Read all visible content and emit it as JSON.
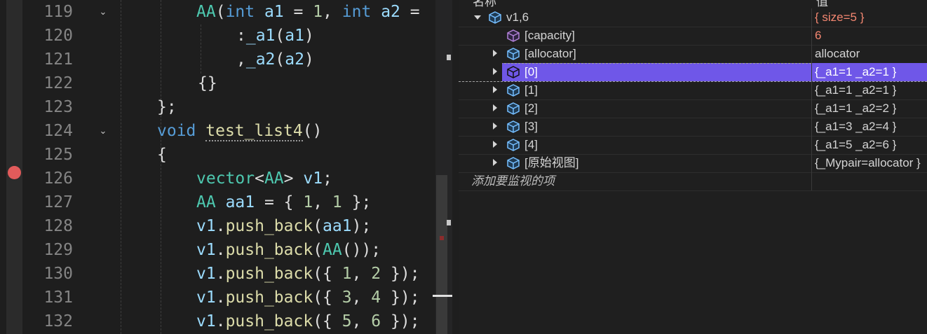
{
  "editor": {
    "lines": [
      {
        "num": "119",
        "code": "AA(int a1 = 1, int a2 ="
      },
      {
        "num": "120",
        "code": ":_a1(a1)"
      },
      {
        "num": "121",
        "code": ",_a2(a2)"
      },
      {
        "num": "122",
        "code": "{}"
      },
      {
        "num": "123",
        "code": "};"
      },
      {
        "num": "124",
        "code": "void test_list4()"
      },
      {
        "num": "125",
        "code": "{"
      },
      {
        "num": "126",
        "code": "vector<AA> v1;"
      },
      {
        "num": "127",
        "code": "AA aa1 = { 1, 1 };"
      },
      {
        "num": "128",
        "code": "v1.push_back(aa1);"
      },
      {
        "num": "129",
        "code": "v1.push_back(AA());"
      },
      {
        "num": "130",
        "code": "v1.push_back({ 1, 2 });"
      },
      {
        "num": "131",
        "code": "v1.push_back({ 3, 4 });"
      },
      {
        "num": "132",
        "code": "v1.push_back({ 5, 6 });"
      }
    ]
  },
  "watch": {
    "header_name": "名称",
    "header_value": "值",
    "rows": [
      {
        "name": "v1,6",
        "value": "{ size=5 }",
        "value_color": "#f48771"
      },
      {
        "name": "[capacity]",
        "value": "6",
        "value_color": "#f48771"
      },
      {
        "name": "[allocator]",
        "value": "allocator",
        "value_color": "#d4d4d4"
      },
      {
        "name": "[0]",
        "value": "{_a1=1 _a2=1 }",
        "value_color": "#ffffff"
      },
      {
        "name": "[1]",
        "value": "{_a1=1 _a2=1 }",
        "value_color": "#d4d4d4"
      },
      {
        "name": "[2]",
        "value": "{_a1=1 _a2=2 }",
        "value_color": "#d4d4d4"
      },
      {
        "name": "[3]",
        "value": "{_a1=3 _a2=4 }",
        "value_color": "#d4d4d4"
      },
      {
        "name": "[4]",
        "value": "{_a1=5 _a2=6 }",
        "value_color": "#d4d4d4"
      },
      {
        "name": "[原始视图]",
        "value": "{_Mypair=allocator }",
        "value_color": "#d4d4d4"
      }
    ],
    "add_placeholder": "添加要监视的项"
  },
  "colors": {
    "selection": "#6f57e8",
    "breakpoint": "#e25b5b",
    "keyword": "#569cd6",
    "type": "#4ec9b0",
    "function": "#dcdcaa",
    "variable": "#9cdcfe",
    "number": "#b5cea8"
  }
}
